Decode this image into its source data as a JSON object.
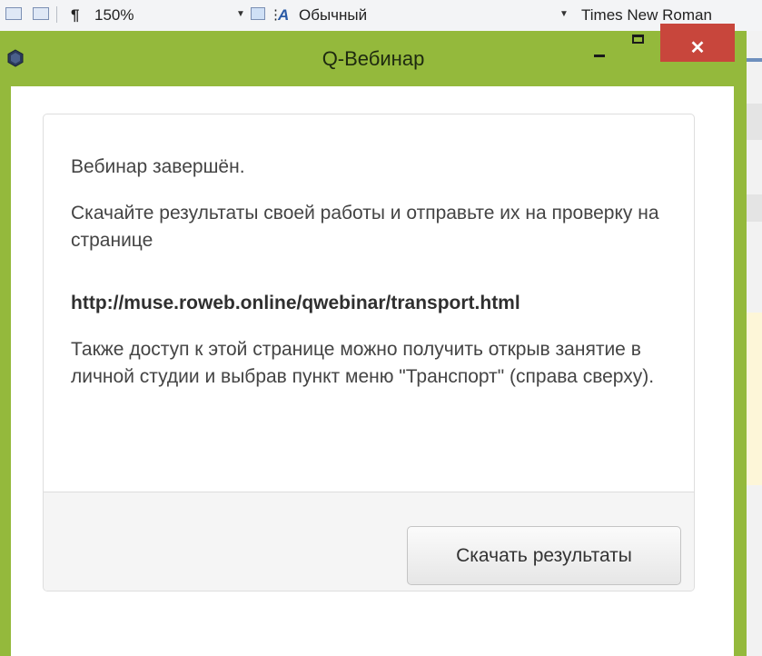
{
  "background_app": {
    "zoom": "150%",
    "style": "Обычный",
    "font": "Times New Roman"
  },
  "window": {
    "title": "Q-Вебинар",
    "accent_color": "#94b93c",
    "close_color": "#c8463c"
  },
  "dialog": {
    "message_finished": "Вебинар завершён.",
    "message_download": "Скачайте результаты своей работы и отправьте их на проверку на странице",
    "url": "http://muse.roweb.online/qwebinar/transport.html",
    "message_access": "Также доступ к этой странице можно получить открыв занятие в личной студии и выбрав пункт меню \"Транспорт\" (справа сверху).",
    "download_button_label": "Скачать результаты"
  },
  "icons": {
    "app": "qwebinar-app-icon",
    "minimize": "minimize-icon",
    "maximize": "maximize-icon",
    "close": "close-icon"
  }
}
